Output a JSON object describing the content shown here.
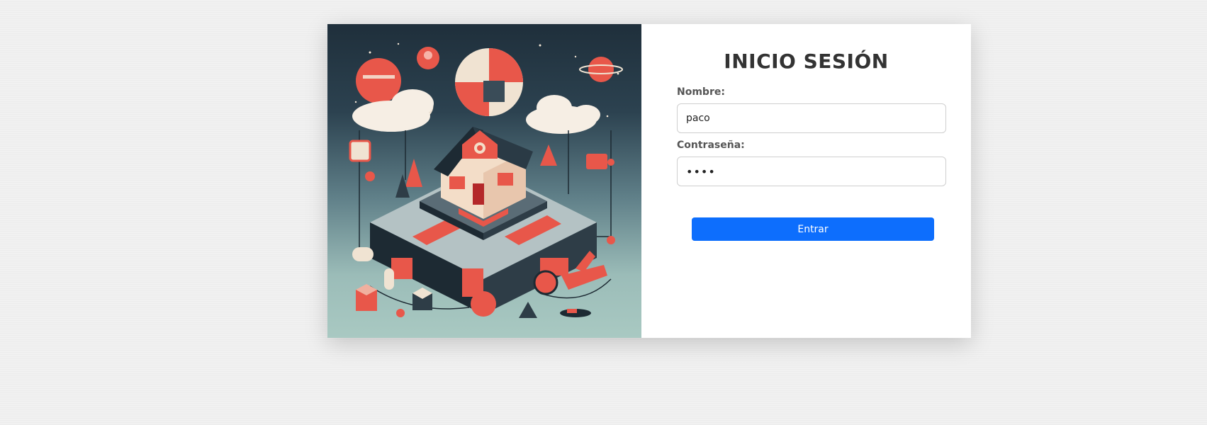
{
  "login": {
    "title": "INICIO SESIÓN",
    "name_label": "Nombre:",
    "name_value": "paco",
    "password_label": "Contraseña:",
    "password_value": "••••",
    "submit_label": "Entrar"
  },
  "illustration": {
    "description_icon": "isometric-house-illustration-icon"
  },
  "colors": {
    "accent": "#0d6efd",
    "title": "#333333",
    "label": "#555555",
    "illustration_red": "#e8574a"
  }
}
